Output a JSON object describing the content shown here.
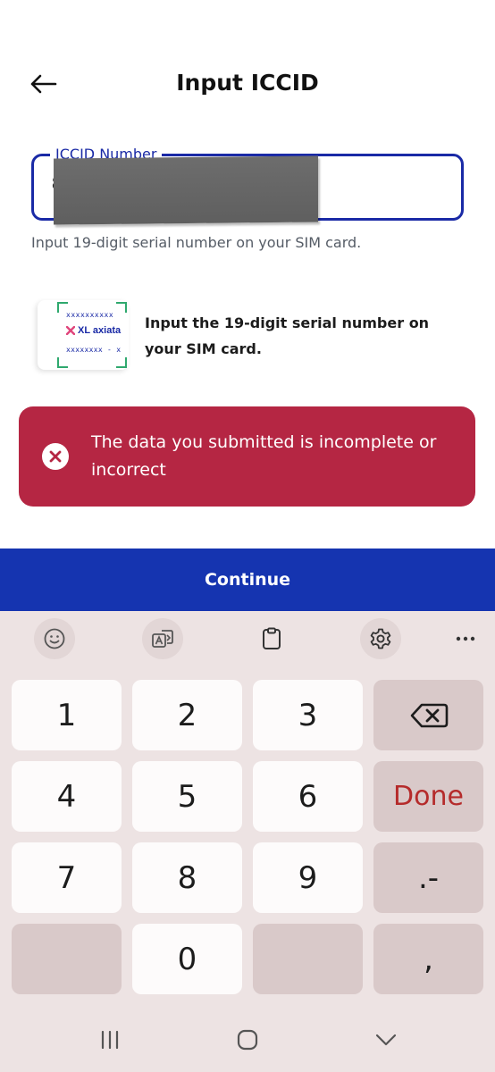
{
  "header": {
    "title": "Input ICCID",
    "back_icon": "arrow-left-icon"
  },
  "iccid_field": {
    "label": "ICCID Number",
    "value": "8",
    "helper": "Input 19-digit serial number on your SIM card.",
    "border_color": "#1a2aa6"
  },
  "sim_hint": {
    "card_line1": "xxxxxxxxxx",
    "card_brand": "XL axiata",
    "card_line2": "xxxxxxxx - x",
    "text": "Input the 19-digit serial number on your SIM card."
  },
  "error": {
    "message": "The data you submitted is incomplete or incorrect",
    "color": "#b52643",
    "icon": "close-circle-icon"
  },
  "continue_button": {
    "label": "Continue",
    "color": "#1534b0"
  },
  "keyboard": {
    "toolbar": [
      "emoji-icon",
      "translate-icon",
      "clipboard-icon",
      "settings-icon",
      "more-icon"
    ],
    "keys": {
      "k1": "1",
      "k2": "2",
      "k3": "3",
      "k4": "4",
      "k5": "5",
      "k6": "6",
      "k7": "7",
      "k8": "8",
      "k9": "9",
      "k0": "0",
      "done": "Done",
      "dot_dash": ".-",
      "comma": ","
    },
    "backspace_icon": "backspace-icon"
  },
  "nav": [
    "recent-apps-icon",
    "home-icon",
    "back-chevron-icon"
  ]
}
